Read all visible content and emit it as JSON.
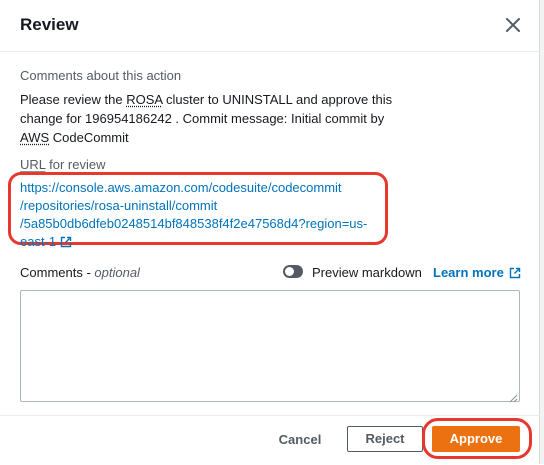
{
  "modal": {
    "title": "Review",
    "close_icon": "close-icon"
  },
  "comments_section": {
    "label": "Comments about this action",
    "line1_pre": "Please review the ",
    "line1_abbr": "ROSA",
    "line1_post": " cluster to UNINSTALL and approve this",
    "line2": "change for 196954186242 . Commit message: Initial commit by",
    "line3_abbr": "AWS",
    "line3_post": " CodeCommit"
  },
  "url_section": {
    "label_abbr": "URL",
    "label_post": " for review",
    "link_lines": [
      "https://console.aws.amazon.com/codesuite/codecommit",
      "/repositories/rosa-uninstall/commit",
      "/5a85b0db6dfeb0248514bf848538f4f2e47568d4?region=us-",
      "east-1"
    ],
    "external_icon": "external-link-icon"
  },
  "comments_input": {
    "label": "Comments - ",
    "optional": "optional",
    "value": "",
    "preview_toggle_label": "Preview markdown",
    "preview_toggle_on": false,
    "learn_more_label": "Learn more"
  },
  "footer": {
    "cancel_label": "Cancel",
    "reject_label": "Reject",
    "approve_label": "Approve"
  },
  "colors": {
    "link": "#0073bb",
    "primary_button": "#ec7211",
    "highlight": "#e8372c"
  }
}
